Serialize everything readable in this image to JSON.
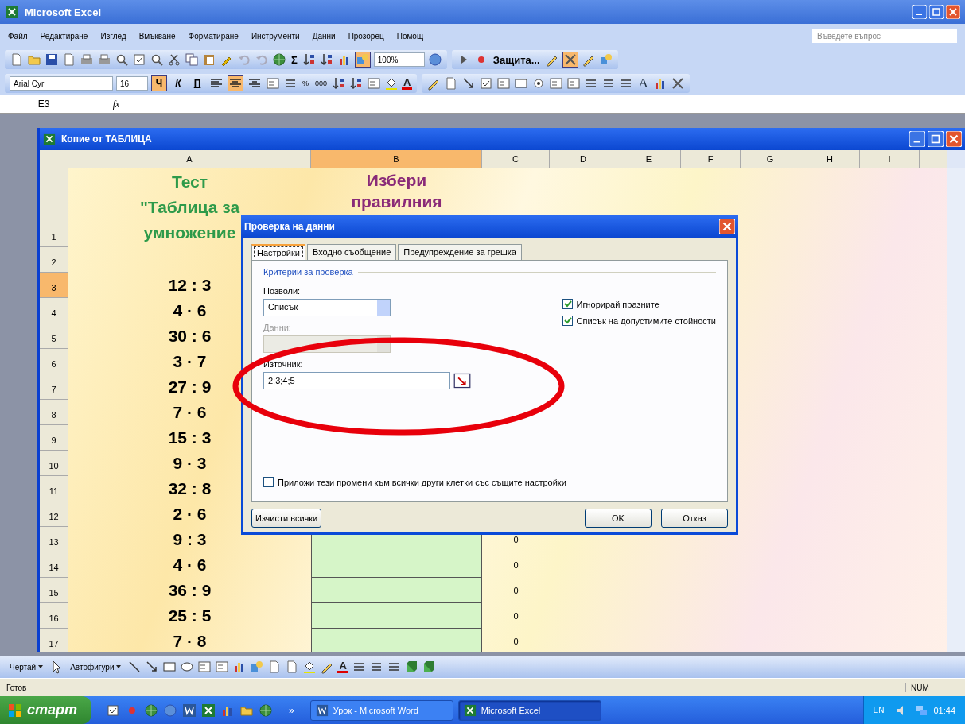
{
  "app_window": {
    "title": "Microsoft Excel"
  },
  "menu": [
    "Файл",
    "Редактиране",
    "Изглед",
    "Вмъкване",
    "Форматиране",
    "Инструменти",
    "Данни",
    "Прозорец",
    "Помощ"
  ],
  "help_search": {
    "placeholder": "Въведете въпрос"
  },
  "standard_toolbar": {
    "autosum": "Σ",
    "zoom": "100%",
    "protect_menu": "Защита...",
    "toggles": [
      {
        "selected": true
      },
      {
        "selected": true
      }
    ]
  },
  "formatting_toolbar": {
    "font": "Arial Cyr",
    "size": "16",
    "styles": [
      {
        "label": "Ч",
        "selected": true
      },
      {
        "label": "К",
        "selected": false
      },
      {
        "label": "П",
        "selected": false
      }
    ],
    "alignments": [
      {
        "kind": "left",
        "selected": false
      },
      {
        "kind": "center",
        "selected": true
      },
      {
        "kind": "right",
        "selected": false
      }
    ],
    "number_buttons": [
      "%",
      "000"
    ],
    "font_color_letter": "A",
    "text_tool_letter": "A"
  },
  "formula_bar": {
    "name_box": "E3",
    "fx": "fx"
  },
  "workbook": {
    "title": "Копие от ТАБЛИЦА",
    "columns": [
      {
        "label": "A",
        "selected": false
      },
      {
        "label": "B",
        "selected": true
      },
      {
        "label": "C",
        "selected": false
      },
      {
        "label": "D",
        "selected": false
      },
      {
        "label": "E",
        "selected": false
      },
      {
        "label": "F",
        "selected": false
      },
      {
        "label": "G",
        "selected": false
      },
      {
        "label": "H",
        "selected": false
      },
      {
        "label": "I",
        "selected": false
      }
    ],
    "rows": [
      {
        "number": "1",
        "selected": false,
        "a": "Тест\n\"Таблица за\nумножение",
        "b": "Избери\nправилния"
      },
      {
        "number": "2",
        "selected": false
      },
      {
        "number": "3",
        "selected": true,
        "a": "12 : 3"
      },
      {
        "number": "4",
        "selected": false,
        "a": "4 · 6"
      },
      {
        "number": "5",
        "selected": false,
        "a": "30 : 6"
      },
      {
        "number": "6",
        "selected": false,
        "a": "3 · 7"
      },
      {
        "number": "7",
        "selected": false,
        "a": "27 : 9"
      },
      {
        "number": "8",
        "selected": false,
        "a": "7 · 6"
      },
      {
        "number": "9",
        "selected": false,
        "a": "15 : 3"
      },
      {
        "number": "10",
        "selected": false,
        "a": "9 · 3"
      },
      {
        "number": "11",
        "selected": false,
        "a": "32 : 8"
      },
      {
        "number": "12",
        "selected": false,
        "a": "2 · 6"
      },
      {
        "number": "13",
        "selected": false,
        "answer_cell": true,
        "a": "9 : 3",
        "c": "0"
      },
      {
        "number": "14",
        "selected": false,
        "answer_cell": true,
        "a": "4 · 6",
        "c": "0"
      },
      {
        "number": "15",
        "selected": false,
        "answer_cell": true,
        "a": "36 : 9",
        "c": "0"
      },
      {
        "number": "16",
        "selected": false,
        "answer_cell": true,
        "a": "25 : 5",
        "c": "0"
      },
      {
        "number": "17",
        "selected": false,
        "answer_cell": true,
        "a": "7 · 8",
        "c": "0"
      }
    ]
  },
  "dialog": {
    "title": "Проверка на данни",
    "tabs": [
      {
        "label": "Настройки",
        "selected": true
      },
      {
        "label": "Входно съобщение",
        "selected": false
      },
      {
        "label": "Предупреждение за грешка",
        "selected": false
      }
    ],
    "group": "Критерии за проверка",
    "allow": {
      "label": "Позволи:",
      "value": "Списък"
    },
    "data": {
      "label": "Данни:",
      "disabled": true
    },
    "source": {
      "label": "Източник:",
      "value": "2;3;4;5"
    },
    "options": [
      {
        "label": "Игнорирай празните",
        "checked": true
      },
      {
        "label": "Списък на допустимите стойности",
        "checked": true
      }
    ],
    "apply_all": {
      "label": "Приложи тези промени към всички други клетки със същите настройки",
      "checked": false
    },
    "buttons": [
      {
        "kind": "clear",
        "label": "Изчисти всички"
      },
      {
        "kind": "ok",
        "label": "OK"
      },
      {
        "kind": "cancel",
        "label": "Отказ"
      }
    ]
  },
  "drawing_toolbar": {
    "draw_menu": "Чертай",
    "autoshapes_menu": "Автофигури",
    "font_color_letter": "A"
  },
  "status_bar": {
    "status": "Готов",
    "num": "NUM"
  },
  "taskbar": {
    "start": "старт",
    "chevron": "»",
    "tasks": [
      {
        "label": "Урок - Microsoft Word",
        "selected": false
      },
      {
        "label": "Microsoft Excel",
        "selected": true
      }
    ],
    "language": "EN",
    "clock": "01:44"
  }
}
